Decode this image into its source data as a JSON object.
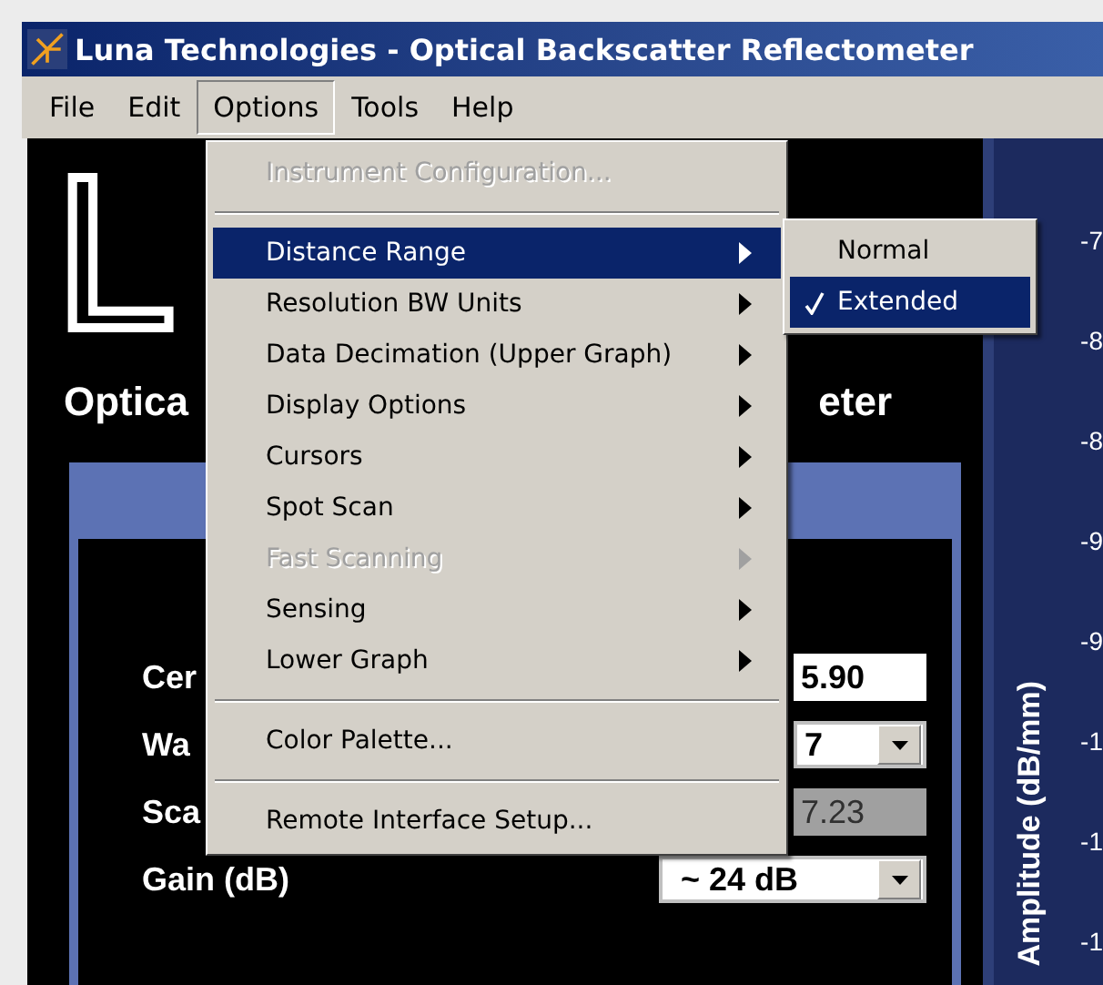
{
  "window": {
    "title": "Luna Technologies - Optical Backscatter Reflectometer"
  },
  "menu_bar": [
    {
      "label": "File",
      "selected": false
    },
    {
      "label": "Edit",
      "selected": false
    },
    {
      "label": "Options",
      "selected": true
    },
    {
      "label": "Tools",
      "selected": false
    },
    {
      "label": "Help",
      "selected": false
    }
  ],
  "logo": {
    "text": "L"
  },
  "subtitle": [
    "Optica",
    "eter"
  ],
  "controls": [
    {
      "label": "Cer",
      "value": "5.90",
      "kind": "input"
    },
    {
      "label": "Wa",
      "value": "7",
      "kind": "dropdown"
    },
    {
      "label": "Sca",
      "value": "7.23",
      "kind": "readonly"
    },
    {
      "label": "Gain (dB)",
      "value": "~ 24 dB",
      "kind": "dropdown"
    }
  ],
  "amplitude_axis": {
    "label": "Amplitude (dB/mm)",
    "ticks": [
      "-7",
      "-8",
      "-8",
      "-9",
      "-9",
      "-1",
      "-1",
      "-1"
    ]
  },
  "options_menu": [
    {
      "kind": "item",
      "label": "Instrument Configuration...",
      "disabled": true,
      "submenu": false,
      "selected": false
    },
    {
      "kind": "separator"
    },
    {
      "kind": "item",
      "label": "Distance Range",
      "disabled": false,
      "submenu": true,
      "selected": true
    },
    {
      "kind": "item",
      "label": "Resolution BW Units",
      "disabled": false,
      "submenu": true,
      "selected": false
    },
    {
      "kind": "item",
      "label": "Data Decimation (Upper Graph)",
      "disabled": false,
      "submenu": true,
      "selected": false
    },
    {
      "kind": "item",
      "label": "Display Options",
      "disabled": false,
      "submenu": true,
      "selected": false
    },
    {
      "kind": "item",
      "label": "Cursors",
      "disabled": false,
      "submenu": true,
      "selected": false
    },
    {
      "kind": "item",
      "label": "Spot Scan",
      "disabled": false,
      "submenu": true,
      "selected": false
    },
    {
      "kind": "item",
      "label": "Fast Scanning",
      "disabled": true,
      "submenu": true,
      "selected": false
    },
    {
      "kind": "item",
      "label": "Sensing",
      "disabled": false,
      "submenu": true,
      "selected": false
    },
    {
      "kind": "item",
      "label": "Lower Graph",
      "disabled": false,
      "submenu": true,
      "selected": false
    },
    {
      "kind": "separator"
    },
    {
      "kind": "item",
      "label": "Color Palette...",
      "disabled": false,
      "submenu": false,
      "selected": false
    },
    {
      "kind": "separator"
    },
    {
      "kind": "item",
      "label": "Remote Interface Setup...",
      "disabled": false,
      "submenu": false,
      "selected": false
    }
  ],
  "submenu": [
    {
      "label": "Normal",
      "checked": false,
      "selected": false
    },
    {
      "label": "Extended",
      "checked": true,
      "selected": true
    }
  ]
}
